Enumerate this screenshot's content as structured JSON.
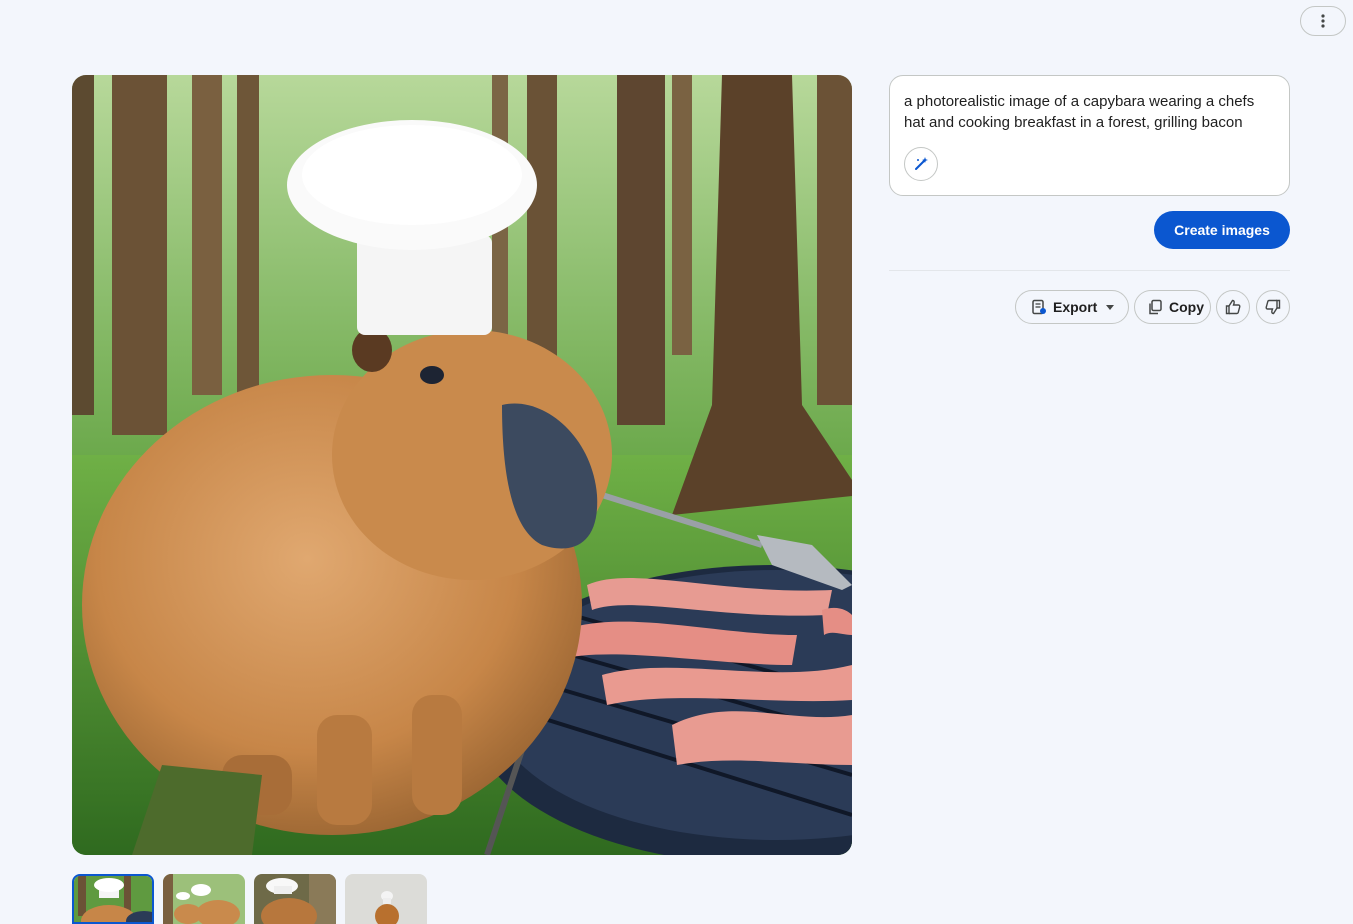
{
  "header": {
    "more_icon": "more-vert-icon"
  },
  "image": {
    "subject": "capybara-chef-grilling-bacon",
    "selected_index": 0
  },
  "thumbnails": [
    {
      "icon": "capybara-thumb-1"
    },
    {
      "icon": "capybara-thumb-2"
    },
    {
      "icon": "capybara-thumb-3"
    },
    {
      "icon": "capybara-thumb-4"
    }
  ],
  "prompt": {
    "text": "a photorealistic image of a capybara wearing a chefs hat and cooking breakfast in a forest, grilling bacon",
    "refine_icon": "magic-wand-icon"
  },
  "actions": {
    "create_label": "Create images",
    "export_label": "Export",
    "copy_label": "Copy",
    "like_icon": "thumb-up-icon",
    "dislike_icon": "thumb-down-icon"
  },
  "colors": {
    "accent": "#0b57d0",
    "background": "#f3f6fc"
  }
}
